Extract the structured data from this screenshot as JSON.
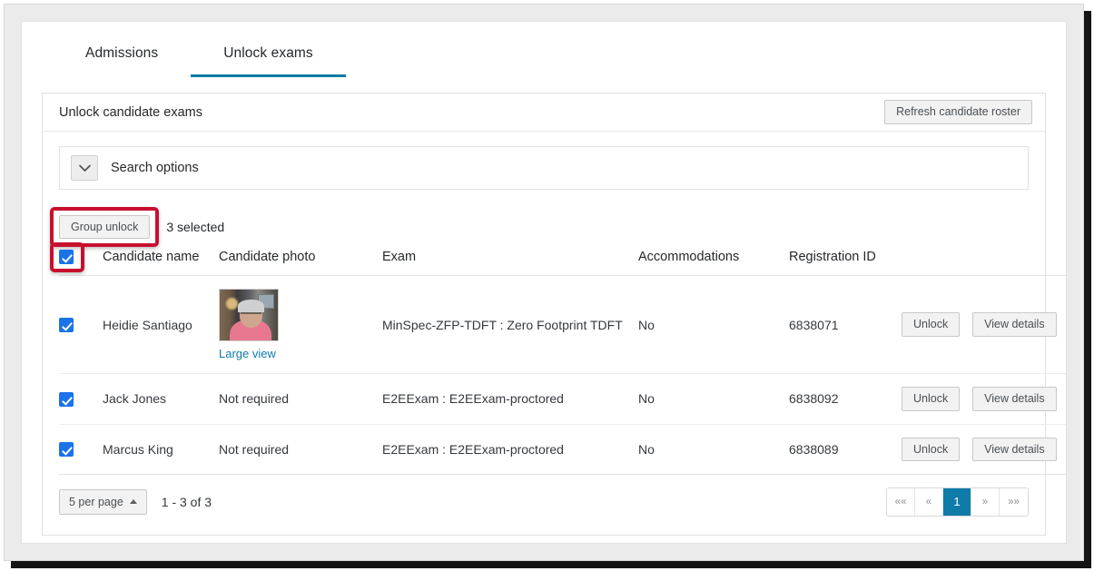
{
  "tabs": [
    {
      "label": "Admissions",
      "active": false
    },
    {
      "label": "Unlock exams",
      "active": true
    }
  ],
  "card": {
    "title": "Unlock candidate exams",
    "refresh_label": "Refresh candidate roster"
  },
  "search": {
    "label": "Search options",
    "chevron_icon": "chevron-down-icon"
  },
  "toolbar": {
    "group_unlock_label": "Group unlock",
    "selected_text": "3 selected"
  },
  "table": {
    "headers": {
      "candidate_name": "Candidate name",
      "candidate_photo": "Candidate photo",
      "exam": "Exam",
      "accommodations": "Accommodations",
      "registration_id": "Registration ID"
    },
    "rows": [
      {
        "checked": true,
        "name": "Heidie Santiago",
        "photo_type": "image",
        "photo_text": "",
        "large_view_label": "Large view",
        "exam": "MinSpec-ZFP-TDFT : Zero Footprint TDFT",
        "accommodations": "No",
        "registration_id": "6838071",
        "unlock_label": "Unlock",
        "view_details_label": "View details"
      },
      {
        "checked": true,
        "name": "Jack Jones",
        "photo_type": "text",
        "photo_text": "Not required",
        "large_view_label": "",
        "exam": "E2EExam : E2EExam-proctored",
        "accommodations": "No",
        "registration_id": "6838092",
        "unlock_label": "Unlock",
        "view_details_label": "View details"
      },
      {
        "checked": true,
        "name": "Marcus King",
        "photo_type": "text",
        "photo_text": "Not required",
        "large_view_label": "",
        "exam": "E2EExam : E2EExam-proctored",
        "accommodations": "No",
        "registration_id": "6838089",
        "unlock_label": "Unlock",
        "view_details_label": "View details"
      }
    ]
  },
  "pager": {
    "per_page_label": "5 per page",
    "range_label": "1 - 3 of 3",
    "buttons": [
      {
        "label": "««",
        "current": false
      },
      {
        "label": "«",
        "current": false
      },
      {
        "label": "1",
        "current": true
      },
      {
        "label": "»",
        "current": false
      },
      {
        "label": "»»",
        "current": false
      }
    ]
  },
  "colors": {
    "accent": "#0e7ba8",
    "checkbox": "#1a73e8",
    "highlight": "#c8102e",
    "link": "#0e7ba8"
  }
}
